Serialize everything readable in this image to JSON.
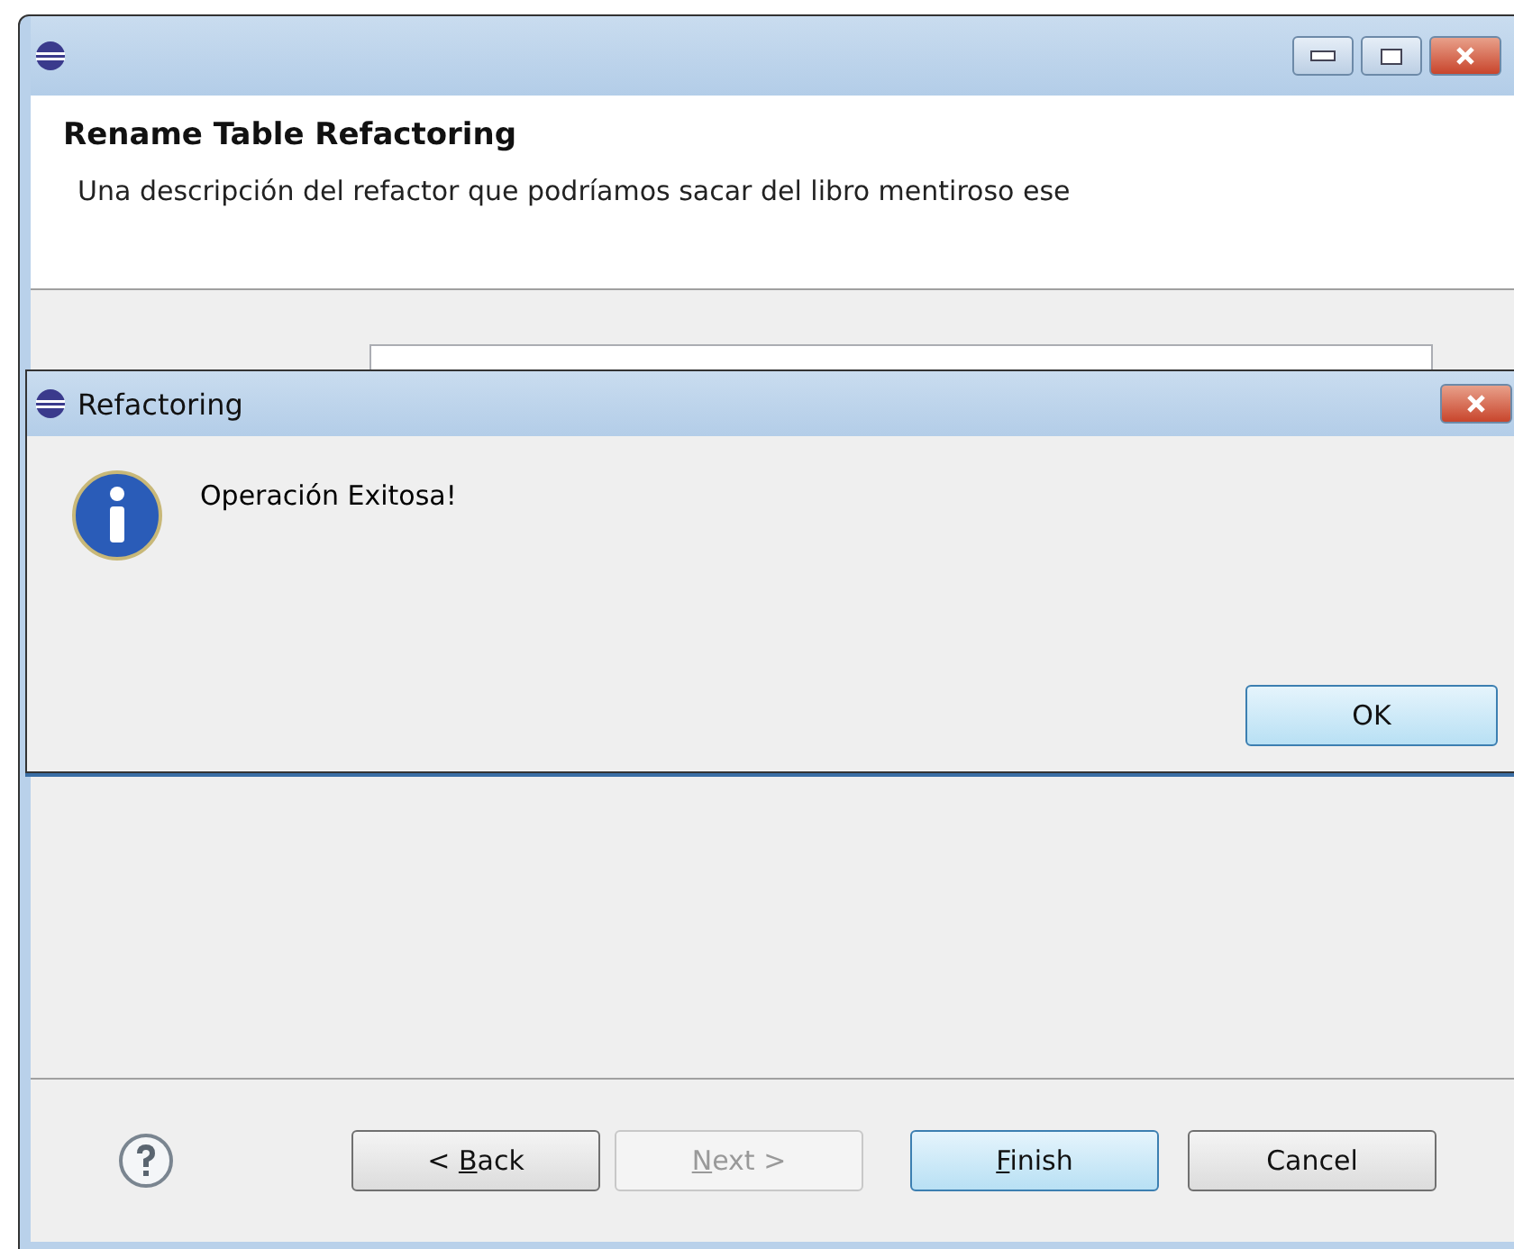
{
  "window": {
    "title": "Rename Table Refactoring",
    "description": "Una descripción del refactor que podríamos sacar del libro mentiroso ese"
  },
  "dialog": {
    "title": "Refactoring",
    "message": "Operación Exitosa!",
    "button": {
      "label": "OK",
      "default": true
    }
  },
  "buttons": [
    {
      "before": "< ",
      "key": "B",
      "after": "ack",
      "disabled": false,
      "default": false
    },
    {
      "key": "N",
      "after": "ext >",
      "disabled": true,
      "default": false
    },
    {
      "key": "F",
      "after": "inish",
      "disabled": false,
      "default": true
    },
    {
      "before": "Cancel",
      "disabled": false,
      "default": false
    }
  ]
}
